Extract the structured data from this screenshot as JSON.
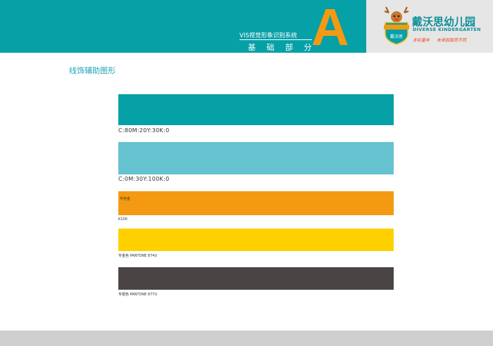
{
  "header": {
    "series_title": "VIS视觉形象识别系统",
    "section_title": "基 础 部 分",
    "section_letter": "A"
  },
  "logo": {
    "emblem_text": "戴沃思",
    "name": "戴沃思幼儿园",
    "subtitle": "DIVERSE KINDERGARTEN",
    "slogan_left": "多彩童年",
    "slogan_right": "未来因我而不同"
  },
  "page_title": "线饰辅助图形",
  "swatches": [
    {
      "color": "#06a0a7",
      "caption": "C:80M:20Y:30K:0"
    },
    {
      "color": "#64c3ce",
      "caption": "C:0M:30Y:100K:0"
    },
    {
      "color": "#f39a12",
      "inside_label": "专色金",
      "caption": "K100"
    },
    {
      "color": "#ffd000",
      "caption": "专金色  PANTONE 874U"
    },
    {
      "color": "#4a4544",
      "caption": "专银色  PANTONE 877U"
    }
  ]
}
